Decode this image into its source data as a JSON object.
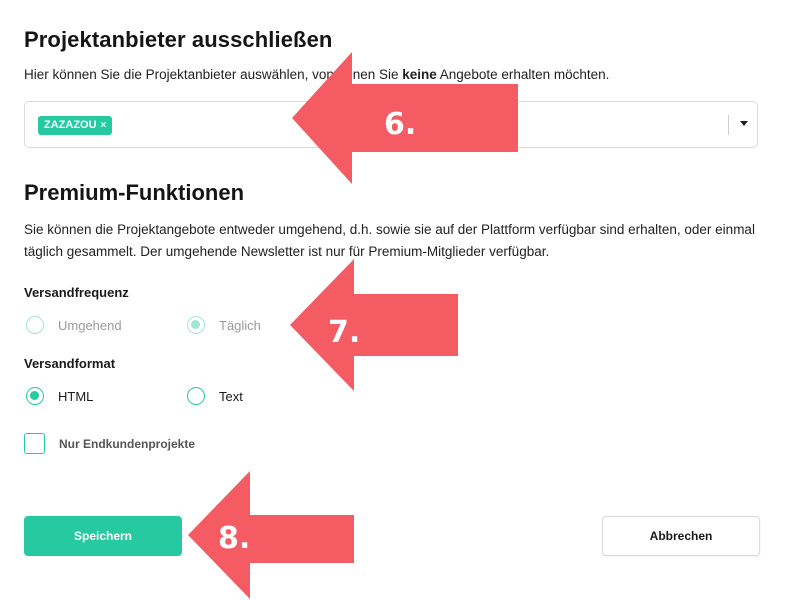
{
  "colors": {
    "accent": "#26c9a0",
    "annotation": "#f45b62",
    "text": "#1a1a1a"
  },
  "provider_section": {
    "title": "Projektanbieter ausschließen",
    "description_before": "Hier können Sie die Projektanbieter auswählen, von denen Sie ",
    "description_bold": "keine",
    "description_after": " Angebote erhalten möchten.",
    "selected_tags": [
      {
        "label": "ZAZAZOU",
        "remove_icon": "×"
      }
    ],
    "dropdown_icon": "chevron-down-icon"
  },
  "premium_section": {
    "title": "Premium-Funktionen",
    "description": "Sie können die Projektangebote entweder umgehend, d.h. sowie sie auf der Plattform verfügbar sind erhalten, oder einmal täglich gesammelt. Der umgehende Newsletter ist nur für Premium-Mitglieder verfügbar.",
    "frequency": {
      "label": "Versandfrequenz",
      "options": [
        {
          "label": "Umgehend",
          "checked": false,
          "disabled": true
        },
        {
          "label": "Täglich",
          "checked": true,
          "disabled": true
        }
      ]
    },
    "format": {
      "label": "Versandformat",
      "options": [
        {
          "label": "HTML",
          "checked": true,
          "disabled": false
        },
        {
          "label": "Text",
          "checked": false,
          "disabled": false
        }
      ]
    },
    "endcustomer_checkbox": {
      "label": "Nur Endkundenprojekte",
      "checked": false
    }
  },
  "buttons": {
    "save": "Speichern",
    "cancel": "Abbrechen"
  },
  "annotations": [
    {
      "number": "6."
    },
    {
      "number": "7."
    },
    {
      "number": "8."
    }
  ]
}
